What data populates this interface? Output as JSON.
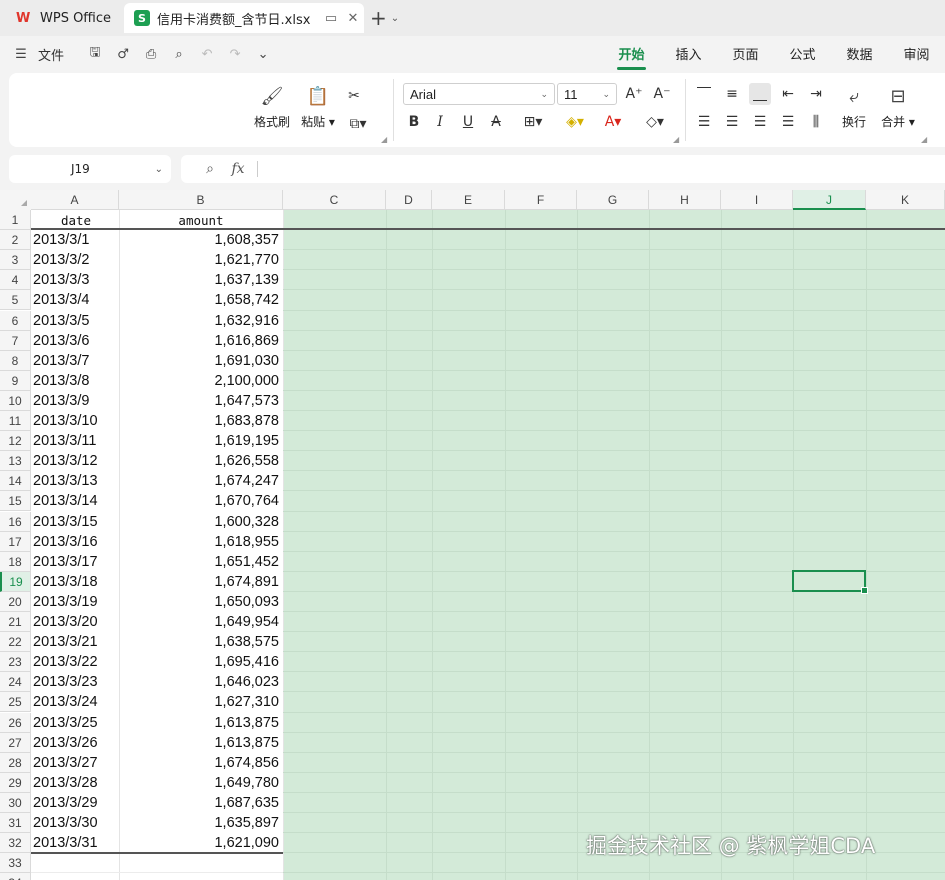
{
  "titlebar": {
    "app_tab": "WPS Office",
    "file_tab": "信用卡消费额_含节日.xlsx",
    "sheet_badge": "S",
    "new_tab": "+"
  },
  "menubar": {
    "file_label": "文件",
    "tabs": [
      "开始",
      "插入",
      "页面",
      "公式",
      "数据",
      "审阅"
    ],
    "active_tab": "开始"
  },
  "ribbon": {
    "format_painter": "格式刷",
    "paste": "粘贴",
    "font_name": "Arial",
    "font_size": "11",
    "wrap_text": "换行",
    "merge": "合并"
  },
  "formula_bar": {
    "name_box": "J19",
    "fx_label": "fx",
    "formula": ""
  },
  "grid": {
    "columns": [
      "A",
      "B",
      "C",
      "D",
      "E",
      "F",
      "G",
      "H",
      "I",
      "J",
      "K"
    ],
    "active_column": "J",
    "active_row": 19,
    "row_numbers": [
      "1",
      "2",
      "3",
      "4",
      "5",
      "6",
      "7",
      "8",
      "9",
      "10",
      "11",
      "12",
      "13",
      "14",
      "15",
      "16",
      "17",
      "18",
      "19",
      "20",
      "21",
      "22",
      "23",
      "24",
      "25",
      "26",
      "27",
      "28",
      "29",
      "30",
      "31",
      "32",
      "33",
      "34"
    ],
    "header": {
      "date": "date",
      "amount": "amount"
    },
    "rows": [
      {
        "date": "2013/3/1",
        "amount": "1,608,357"
      },
      {
        "date": "2013/3/2",
        "amount": "1,621,770"
      },
      {
        "date": "2013/3/3",
        "amount": "1,637,139"
      },
      {
        "date": "2013/3/4",
        "amount": "1,658,742"
      },
      {
        "date": "2013/3/5",
        "amount": "1,632,916"
      },
      {
        "date": "2013/3/6",
        "amount": "1,616,869"
      },
      {
        "date": "2013/3/7",
        "amount": "1,691,030"
      },
      {
        "date": "2013/3/8",
        "amount": "2,100,000"
      },
      {
        "date": "2013/3/9",
        "amount": "1,647,573"
      },
      {
        "date": "2013/3/10",
        "amount": "1,683,878"
      },
      {
        "date": "2013/3/11",
        "amount": "1,619,195"
      },
      {
        "date": "2013/3/12",
        "amount": "1,626,558"
      },
      {
        "date": "2013/3/13",
        "amount": "1,674,247"
      },
      {
        "date": "2013/3/14",
        "amount": "1,670,764"
      },
      {
        "date": "2013/3/15",
        "amount": "1,600,328"
      },
      {
        "date": "2013/3/16",
        "amount": "1,618,955"
      },
      {
        "date": "2013/3/17",
        "amount": "1,651,452"
      },
      {
        "date": "2013/3/18",
        "amount": "1,674,891"
      },
      {
        "date": "2013/3/19",
        "amount": "1,650,093"
      },
      {
        "date": "2013/3/20",
        "amount": "1,649,954"
      },
      {
        "date": "2013/3/21",
        "amount": "1,638,575"
      },
      {
        "date": "2013/3/22",
        "amount": "1,695,416"
      },
      {
        "date": "2013/3/23",
        "amount": "1,646,023"
      },
      {
        "date": "2013/3/24",
        "amount": "1,627,310"
      },
      {
        "date": "2013/3/25",
        "amount": "1,613,875"
      },
      {
        "date": "2013/3/26",
        "amount": "1,613,875"
      },
      {
        "date": "2013/3/27",
        "amount": "1,674,856"
      },
      {
        "date": "2013/3/28",
        "amount": "1,649,780"
      },
      {
        "date": "2013/3/29",
        "amount": "1,687,635"
      },
      {
        "date": "2013/3/30",
        "amount": "1,635,897"
      },
      {
        "date": "2013/3/31",
        "amount": "1,621,090"
      }
    ]
  },
  "watermark": "掘金技术社区 @ 紫枫学姐CDA"
}
